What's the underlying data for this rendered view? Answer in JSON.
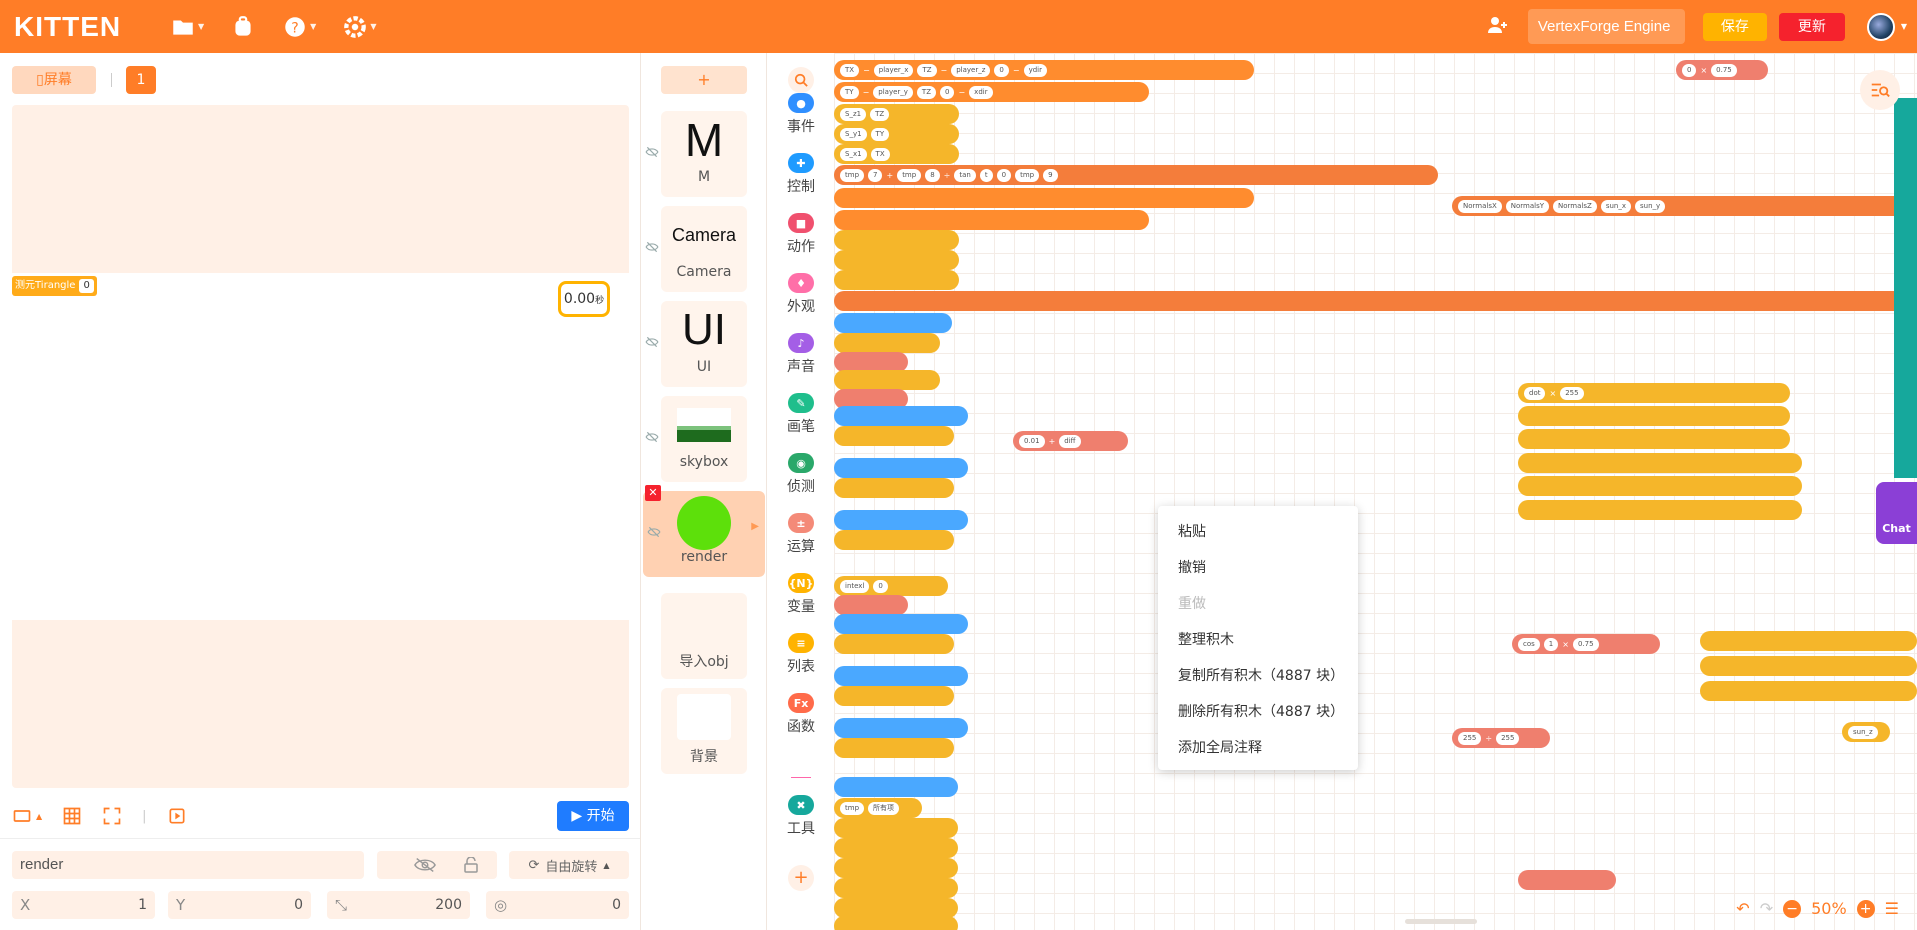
{
  "app": {
    "logo": "KITTEN"
  },
  "header": {
    "project_name": "VertexForge Engine",
    "save_label": "保存",
    "update_label": "更新"
  },
  "stage": {
    "screen_label": "屏幕",
    "page_number": "1",
    "variable_monitor": {
      "name": "测元Tirangle",
      "value": "0"
    },
    "timer": {
      "value": "0.00",
      "unit": "秒"
    },
    "start_label": "开始"
  },
  "sprite_props": {
    "name": "render",
    "rotation_mode": "自由旋转",
    "x_label": "X",
    "x_value": "1",
    "y_label": "Y",
    "y_value": "0",
    "size_value": "200",
    "direction_value": "0"
  },
  "sprites": {
    "add_label": "+",
    "items": [
      {
        "thumb": "M",
        "label": "M"
      },
      {
        "thumb": "Camera",
        "label": "Camera"
      },
      {
        "thumb": "UI",
        "label": "UI"
      },
      {
        "thumb": "",
        "label": "skybox"
      },
      {
        "thumb": "",
        "label": "render"
      },
      {
        "thumb": "",
        "label": "导入obj"
      },
      {
        "thumb": "",
        "label": "背景"
      }
    ]
  },
  "categories": [
    {
      "label": "事件",
      "color": "#2f8fff",
      "icon": "toggle-icon"
    },
    {
      "label": "控制",
      "color": "#1f9bff",
      "icon": "gamepad-icon"
    },
    {
      "label": "动作",
      "color": "#f0506e",
      "icon": "robot-icon"
    },
    {
      "label": "外观",
      "color": "#ff6fa8",
      "icon": "shirt-icon"
    },
    {
      "label": "声音",
      "color": "#a45ee6",
      "icon": "music-icon"
    },
    {
      "label": "画笔",
      "color": "#1fbe8c",
      "icon": "pen-icon"
    },
    {
      "label": "侦测",
      "color": "#2aa86a",
      "icon": "radar-icon"
    },
    {
      "label": "运算",
      "color": "#f48a78",
      "icon": "operator-icon"
    },
    {
      "label": "变量",
      "color": "#ffb300",
      "icon": "variable-icon"
    },
    {
      "label": "列表",
      "color": "#ffb300",
      "icon": "list-icon"
    },
    {
      "label": "函数",
      "color": "#ff6b4a",
      "icon": "function-icon"
    },
    {
      "label": "工具",
      "color": "#16a89c",
      "icon": "wrench-icon"
    }
  ],
  "context_menu": [
    {
      "label": "粘贴",
      "disabled": false
    },
    {
      "label": "撤销",
      "disabled": false
    },
    {
      "label": "重做",
      "disabled": true
    },
    {
      "label": "整理积木",
      "disabled": false
    },
    {
      "label": "复制所有积木（4887 块）",
      "disabled": false
    },
    {
      "label": "删除所有积木（4887 块）",
      "disabled": false
    },
    {
      "label": "添加全局注释",
      "disabled": false
    }
  ],
  "workspace": {
    "zoom": "50%",
    "chat_label": "Chat",
    "block_texts": {
      "b1a": "TX",
      "b1b": "player_x",
      "b1c": "TZ",
      "b1d": "player_z",
      "b1e": "0",
      "b1f": "ydir",
      "b2a": "TY",
      "b2b": "player_y",
      "b2c": "TZ",
      "b2d": "0",
      "b2e": "xdir",
      "b3a": "S_z1",
      "b3b": "TZ",
      "b4a": "S_y1",
      "b4b": "TY",
      "b5a": "S_x1",
      "b5b": "TX",
      "b6a": "tmp",
      "b6b": "7",
      "b6c": "tmp",
      "b6d": "8",
      "b6e": "tan",
      "b6f": "t",
      "b6g": "0",
      "b6h": "tmp",
      "b6i": "9",
      "b7a": "0.01",
      "b7b": "diff",
      "b8a": "dot",
      "b8b": "255",
      "b9a": "NormalsX",
      "b9b": "NormalsY",
      "b9c": "NormalsZ",
      "b9d": "sun_x",
      "b9e": "sun_y",
      "b10a": "cos",
      "b10b": "1",
      "b10c": "0.75",
      "b11a": "255",
      "b11b": "255",
      "b12a": "sun_z",
      "b13a": "0",
      "b13b": "0.75",
      "b14a": "intexl",
      "b14b": "0",
      "b15a": "tmp",
      "b15b": "所有项"
    }
  },
  "colors": {
    "brand": "#ff7d27",
    "save": "#ffb300",
    "update": "#f5222d",
    "start": "#1f7cff"
  }
}
